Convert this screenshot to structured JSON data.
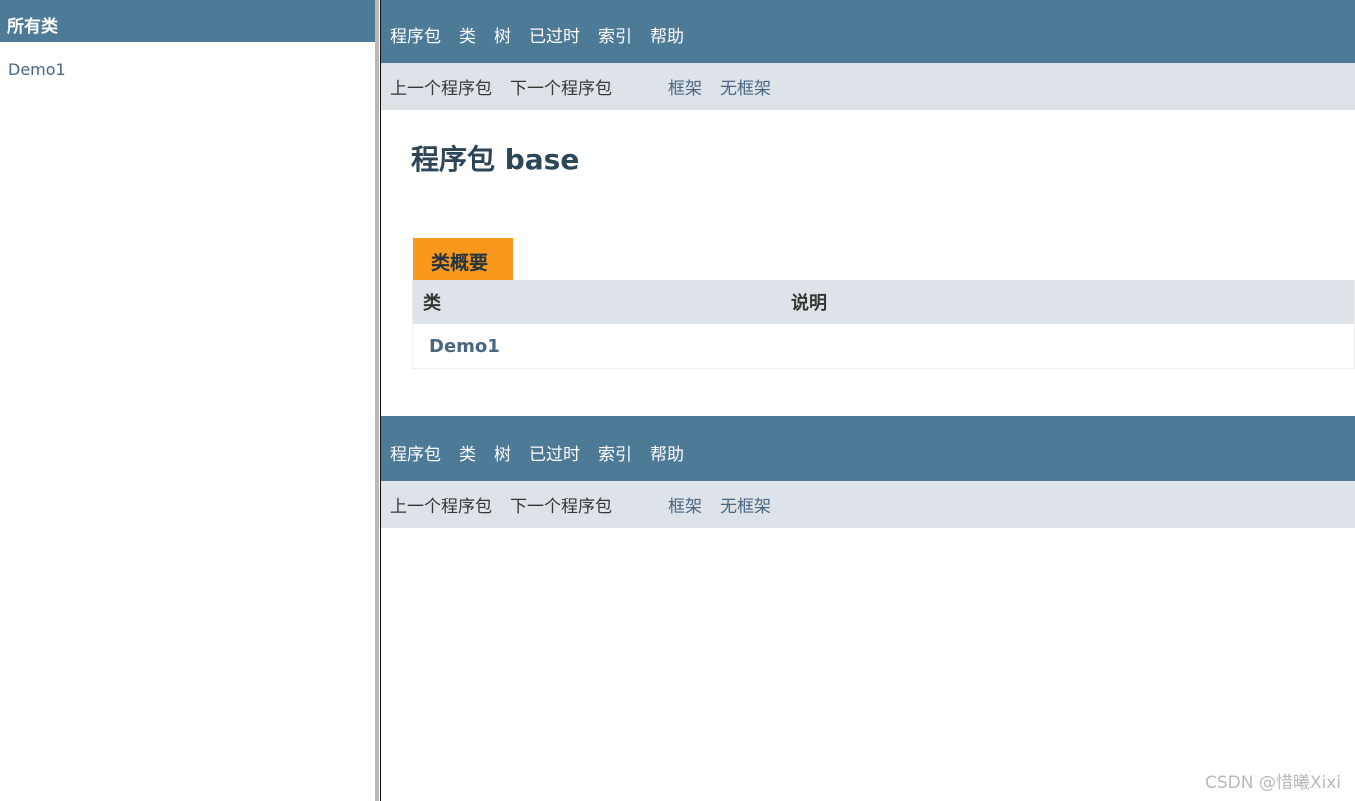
{
  "left_frame": {
    "header": "所有类",
    "classes": [
      "Demo1"
    ]
  },
  "top_nav": {
    "items": [
      "程序包",
      "类",
      "树",
      "已过时",
      "索引",
      "帮助"
    ]
  },
  "sub_nav": {
    "prev_package": "上一个程序包",
    "next_package": "下一个程序包",
    "frames": "框架",
    "no_frames": "无框架"
  },
  "page": {
    "title": "程序包 base"
  },
  "class_summary": {
    "caption": "类概要",
    "headers": [
      "类",
      "说明"
    ],
    "rows": [
      {
        "class": "Demo1",
        "description": ""
      }
    ]
  },
  "watermark": "CSDN @惜曦Xixi",
  "colors": {
    "nav_bar": "#4d7a97",
    "sub_nav": "#dee3e9",
    "caption_tab": "#f8981d",
    "link": "#4a6782"
  }
}
